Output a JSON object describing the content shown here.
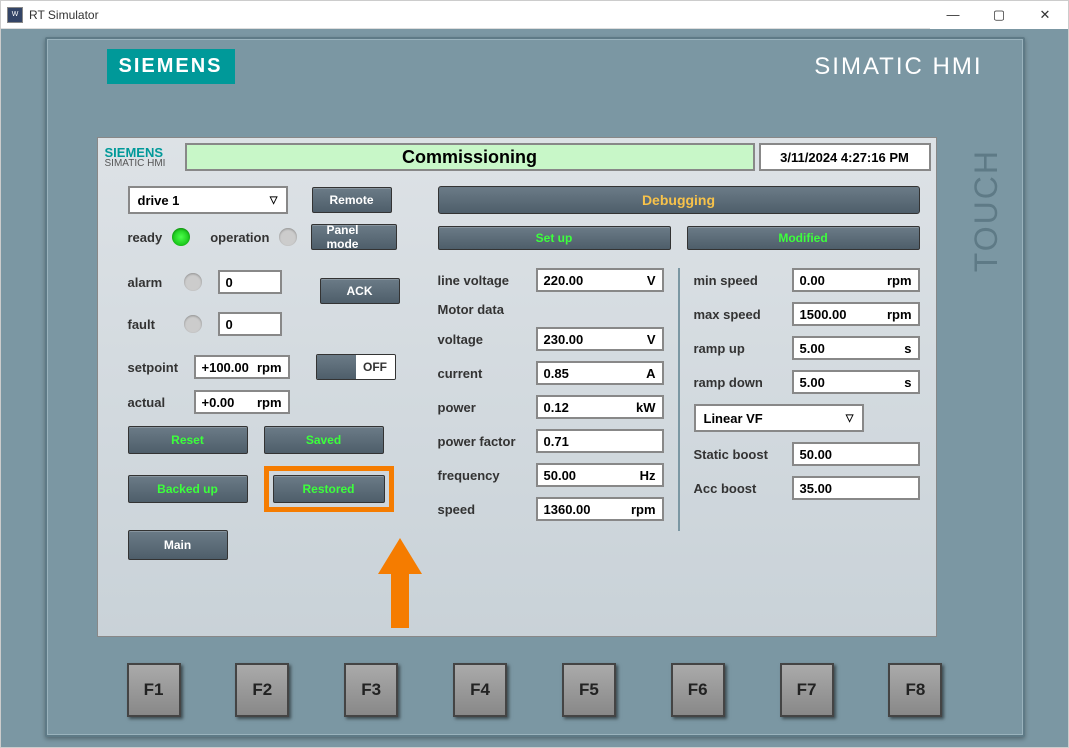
{
  "window": {
    "title": "RT Simulator"
  },
  "bezel": {
    "logo": "SIEMENS",
    "product": "SIMATIC HMI",
    "touch": "TOUCH"
  },
  "header": {
    "brand_top": "SIEMENS",
    "brand_bottom": "SIMATIC HMI",
    "page_title": "Commissioning",
    "timestamp": "3/11/2024 4:27:16 PM"
  },
  "left": {
    "drive_select": "drive 1",
    "remote": "Remote",
    "panel_mode": "Panel mode",
    "ack": "ACK",
    "ready": "ready",
    "operation": "operation",
    "alarm": "alarm",
    "alarm_val": "0",
    "fault": "fault",
    "fault_val": "0",
    "setpoint": "setpoint",
    "setpoint_val": "+100.00",
    "setpoint_unit": "rpm",
    "actual": "actual",
    "actual_val": "+0.00",
    "actual_unit": "rpm",
    "toggle_off": "OFF",
    "reset": "Reset",
    "saved": "Saved",
    "backed_up": "Backed up",
    "restored": "Restored",
    "main": "Main"
  },
  "right": {
    "debugging": "Debugging",
    "setup": "Set up",
    "modified": "Modified",
    "labels": {
      "line_voltage": "line voltage",
      "motor_data": "Motor data",
      "voltage": "voltage",
      "current": "current",
      "power": "power",
      "power_factor": "power factor",
      "frequency": "frequency",
      "speed": "speed",
      "min_speed": "min speed",
      "max_speed": "max speed",
      "ramp_up": "ramp up",
      "ramp_down": "ramp down",
      "vf_mode": "Linear VF",
      "static_boost": "Static boost",
      "acc_boost": "Acc boost"
    },
    "vals": {
      "line_voltage": "220.00",
      "line_voltage_u": "V",
      "voltage": "230.00",
      "voltage_u": "V",
      "current": "0.85",
      "current_u": "A",
      "power": "0.12",
      "power_u": "kW",
      "power_factor": "0.71",
      "frequency": "50.00",
      "frequency_u": "Hz",
      "speed": "1360.00",
      "speed_u": "rpm",
      "min_speed": "0.00",
      "min_speed_u": "rpm",
      "max_speed": "1500.00",
      "max_speed_u": "rpm",
      "ramp_up": "5.00",
      "ramp_up_u": "s",
      "ramp_down": "5.00",
      "ramp_down_u": "s",
      "static_boost": "50.00",
      "acc_boost": "35.00"
    }
  },
  "fkeys": [
    "F1",
    "F2",
    "F3",
    "F4",
    "F5",
    "F6",
    "F7",
    "F8"
  ]
}
